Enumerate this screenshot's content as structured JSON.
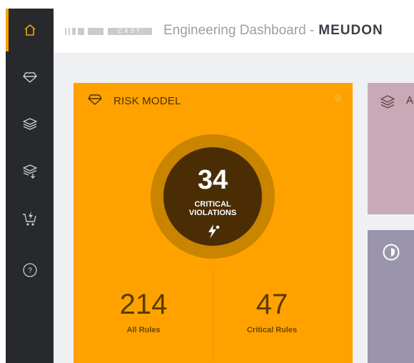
{
  "sidebar": {
    "items": [
      {
        "icon": "home-icon",
        "active": true
      },
      {
        "icon": "diamond-icon",
        "active": false
      },
      {
        "icon": "layers-icon",
        "active": false
      },
      {
        "icon": "layers-down-icon",
        "active": false
      },
      {
        "icon": "cart-bolt-icon",
        "active": false
      },
      {
        "icon": "help-icon",
        "active": false
      }
    ]
  },
  "header": {
    "logo_text": "CAST",
    "title": "Engineering Dashboard -",
    "app_name": "MEUDON"
  },
  "risk_model": {
    "title": "RISK MODEL",
    "critical_count": "34",
    "critical_label_line1": "CRITICAL",
    "critical_label_line2": "VIOLATIONS",
    "all_rules_value": "214",
    "all_rules_label": "All Rules",
    "critical_rules_value": "47",
    "critical_rules_label": "Critical Rules"
  },
  "cards": {
    "pink_label": "A"
  },
  "colors": {
    "accent": "#f5a000",
    "risk_card": "#ffa200",
    "ring": "#c98400",
    "core": "#4a2d05",
    "sidebar": "#27292d",
    "pink_card": "#c9a9b5",
    "purple_card": "#9a94ad"
  }
}
